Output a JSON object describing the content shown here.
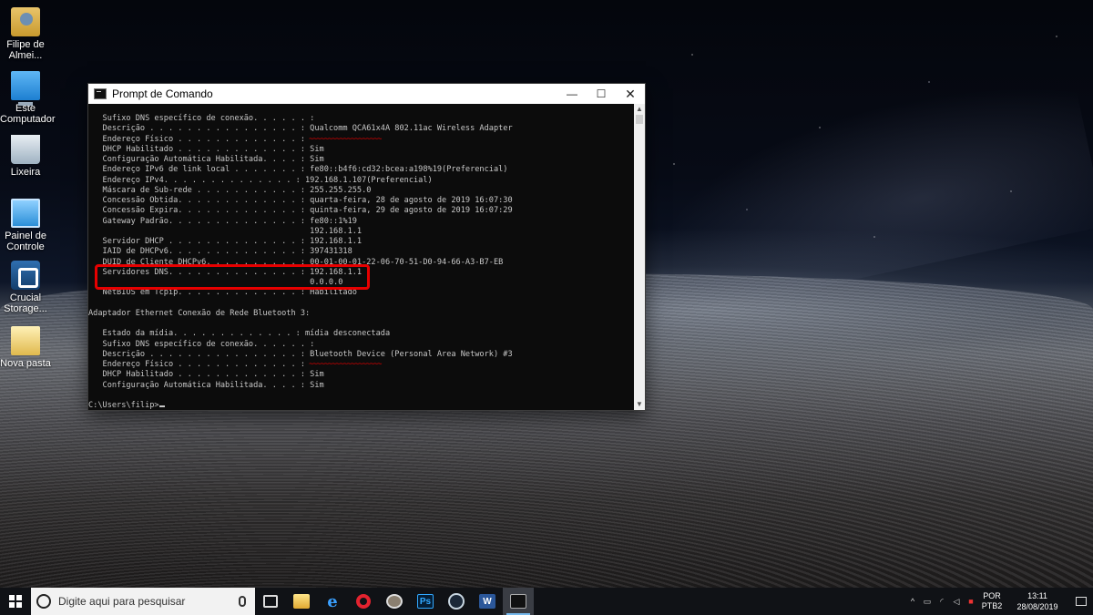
{
  "desktop_icons": [
    {
      "label": "Filipe de Almei...",
      "icon": "user-folder-icon"
    },
    {
      "label": "Este Computador",
      "icon": "computer-icon"
    },
    {
      "label": "Lixeira",
      "icon": "recycle-bin-icon"
    },
    {
      "label": "Painel de Controle",
      "icon": "control-panel-icon"
    },
    {
      "label": "Crucial Storage...",
      "icon": "crucial-storage-icon"
    },
    {
      "label": "Nova pasta",
      "icon": "folder-icon"
    }
  ],
  "window": {
    "title": "Prompt de Comando",
    "minimize": "—",
    "maximize": "☐",
    "close": "✕"
  },
  "console": {
    "lines": [
      "   Sufixo DNS específico de conexão. . . . . . :",
      "   Descrição . . . . . . . . . . . . . . . . : Qualcomm QCA61x4A 802.11ac Wireless Adapter",
      "   Endereço Físico . . . . . . . . . . . . . :",
      "   DHCP Habilitado . . . . . . . . . . . . . : Sim",
      "   Configuração Automática Habilitada. . . . : Sim",
      "   Endereço IPv6 de link local . . . . . . . : fe80::b4f6:cd32:bcea:a198%19(Preferencial)",
      "   Endereço IPv4. . . . . . . . . . . . . . : 192.168.1.107(Preferencial)",
      "   Máscara de Sub-rede . . . . . . . . . . . : 255.255.255.0",
      "   Concessão Obtida. . . . . . . . . . . . . : quarta-feira, 28 de agosto de 2019 16:07:30",
      "   Concessão Expira. . . . . . . . . . . . . : quinta-feira, 29 de agosto de 2019 16:07:29",
      "   Gateway Padrão. . . . . . . . . . . . . . : fe80::1%19",
      "                                               192.168.1.1",
      "   Servidor DHCP . . . . . . . . . . . . . . : 192.168.1.1",
      "   IAID de DHCPv6. . . . . . . . . . . . . . : 397431318",
      "   DUID de Cliente DHCPv6. . . . . . . . . . : 00-01-00-01-22-06-70-51-D0-94-66-A3-B7-EB",
      "   Servidores DNS. . . . . . . . . . . . . . : 192.168.1.1",
      "                                               0.0.0.0",
      "   NetBIOS em Tcpip. . . . . . . . . . . . . : Habilitado",
      "",
      "Adaptador Ethernet Conexão de Rede Bluetooth 3:",
      "",
      "   Estado da mídia. . . . . . . . . . . . . : mídia desconectada",
      "   Sufixo DNS específico de conexão. . . . . . :",
      "   Descrição . . . . . . . . . . . . . . . . : Bluetooth Device (Personal Area Network) #3",
      "   Endereço Físico . . . . . . . . . . . . . :",
      "   DHCP Habilitado . . . . . . . . . . . . . : Sim",
      "   Configuração Automática Habilitada. . . . : Sim",
      "",
      "C:\\Users\\filip>"
    ],
    "redaction_color": "#e00000"
  },
  "annotation": {
    "color": "#e60000"
  },
  "taskbar": {
    "search_placeholder": "Digite aqui para pesquisar",
    "apps": [
      {
        "name": "task-view",
        "glyph": ""
      },
      {
        "name": "file-explorer",
        "glyph": ""
      },
      {
        "name": "edge",
        "glyph": "e"
      },
      {
        "name": "opera",
        "glyph": ""
      },
      {
        "name": "gimp",
        "glyph": ""
      },
      {
        "name": "photoshop",
        "glyph": "Ps"
      },
      {
        "name": "steam",
        "glyph": ""
      },
      {
        "name": "word",
        "glyph": "W"
      },
      {
        "name": "command-prompt",
        "glyph": ""
      }
    ],
    "tray": {
      "lang_top": "POR",
      "lang_bottom": "PTB2",
      "time": "13:11",
      "date": "28/08/2019"
    }
  }
}
